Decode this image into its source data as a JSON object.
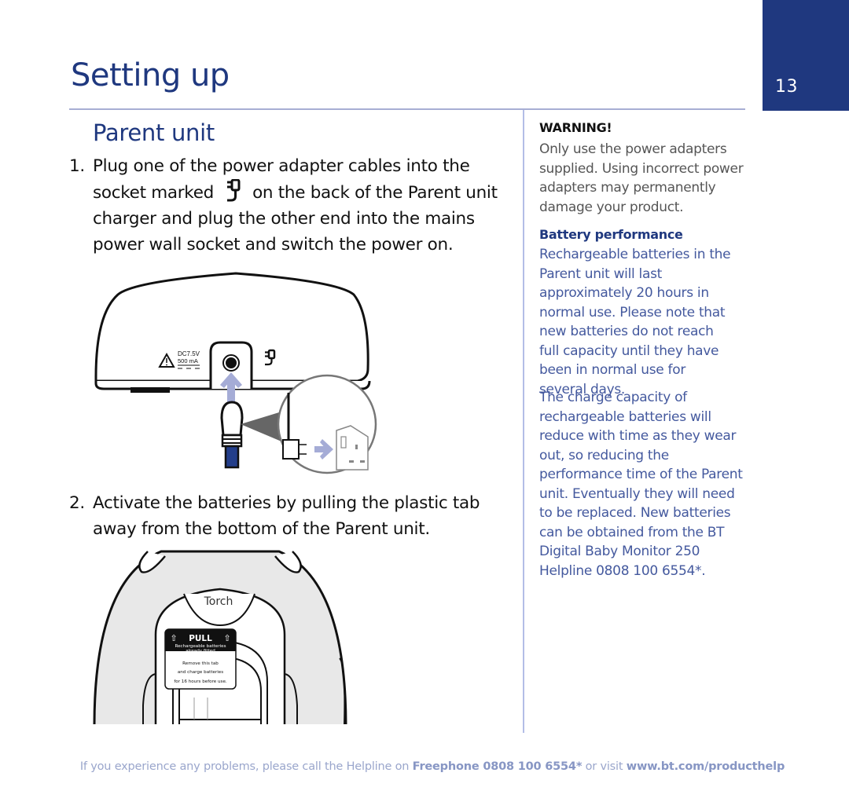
{
  "page": {
    "number": "13",
    "title": "Setting up",
    "section_title": "Parent unit"
  },
  "steps": [
    {
      "number": "1.",
      "text_before_icon": "Plug one of the power adapter cables into the socket marked",
      "icon": "power-adapter-socket-icon",
      "text_after_icon": "on the back of the Parent unit charger and plug the other end into the mains power wall socket and switch the power on."
    },
    {
      "number": "2.",
      "text": "Activate the batteries by pulling the plastic tab away from the bottom of the Parent unit."
    }
  ],
  "figure1": {
    "rating_line1": "DC7.5V",
    "rating_line2": "500 mA",
    "icons": [
      "warning-triangle-icon",
      "power-adapter-socket-icon",
      "up-arrow-icon",
      "right-arrow-icon",
      "wall-socket-icon"
    ]
  },
  "figure2": {
    "button_label": "Torch",
    "tab_header": "PULL",
    "tab_line1": "Rechargeable batteries",
    "tab_line2": "already fitted",
    "tab_line3": "Remove this tab",
    "tab_line4": "and charge batteries",
    "tab_line5": "for 16  hours before use."
  },
  "sidebar": {
    "warning_heading": "WARNING!",
    "warning_text": "Only use the power adapters supplied. Using incorrect power adapters may permanently damage your product.",
    "battery_heading": "Battery performance",
    "battery_text_1": "Rechargeable batteries in the Parent unit will last approximately 20 hours in normal use. Please note that new batteries do not reach full capacity until they have been in normal use for several days.",
    "battery_text_2": "The charge capacity of rechargeable batteries will reduce with time as they wear out, so reducing the performance time of the Parent unit. Eventually they will need to be replaced. New batteries can be obtained from the BT Digital Baby Monitor 250 Helpline 0808 100 6554*."
  },
  "footer": {
    "text_1": "If you experience any problems, please call the Helpline on ",
    "freephone": "Freephone 0808 100 6554*",
    "text_2": " or visit ",
    "url": "www.bt.com/producthelp"
  },
  "colors": {
    "brand_blue": "#1f387f",
    "body_blue": "#44599e",
    "rule": "#a7aed4",
    "arrow": "#a5acd6"
  }
}
